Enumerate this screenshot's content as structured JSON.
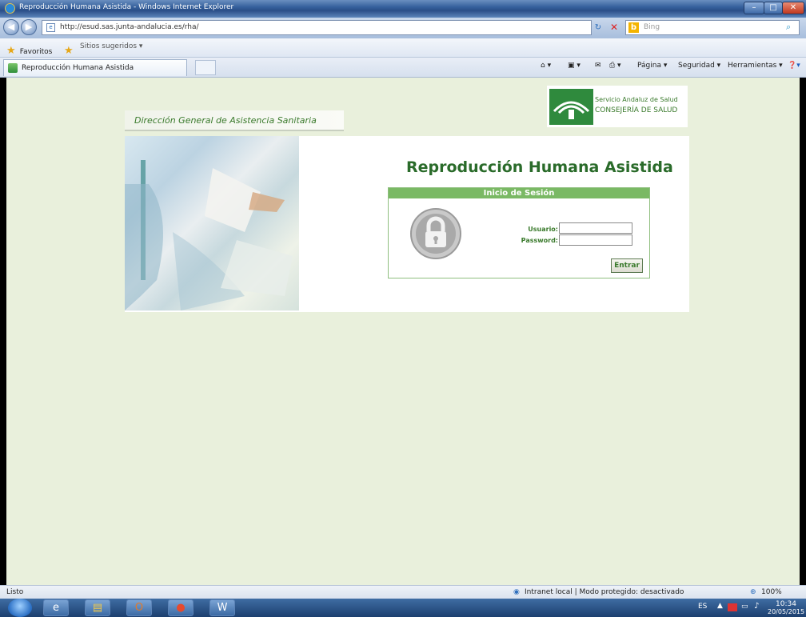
{
  "window": {
    "title": "Reproducción Humana Asistida - Windows Internet Explorer"
  },
  "address": {
    "url": "http://esud.sas.junta-andalucia.es/rha/"
  },
  "search": {
    "placeholder": "Bing"
  },
  "favorites_bar": {
    "favorites_label": "Favoritos",
    "suggested_label": "Sitios sugeridos ▾"
  },
  "tab": {
    "title": "Reproducción Humana Asistida"
  },
  "command_bar": {
    "page": "Página ▾",
    "security": "Seguridad ▾",
    "tools": "Herramientas ▾"
  },
  "page": {
    "header_title": "Dirección General de Asistencia Sanitaria",
    "logo_line1": "Servicio Andaluz de Salud",
    "logo_line2": "CONSEJERÍA DE SALUD",
    "app_title": "Reproducción Humana Asistida",
    "login": {
      "header": "Inicio de Sesión",
      "user_label": "Usuario:",
      "password_label": "Password:",
      "submit": "Entrar",
      "user_value": "",
      "password_value": ""
    }
  },
  "status": {
    "text": "Listo",
    "zone": "Intranet local | Modo protegido: desactivado",
    "zoom": "100%"
  },
  "taskbar": {
    "language": "ES",
    "time": "10:34",
    "date": "20/05/2015"
  },
  "colors": {
    "accent": "#3a7a2c",
    "page_bg": "#e9f0dc",
    "login_header": "#7ab964"
  },
  "icons": [
    "ie-icon",
    "back-arrow-icon",
    "forward-arrow-icon",
    "refresh-icon",
    "stop-icon",
    "bing-icon",
    "search-icon",
    "favorites-star-icon",
    "home-icon",
    "feeds-icon",
    "mail-icon",
    "print-icon",
    "help-icon",
    "lock-icon",
    "globe-icon",
    "start-orb-icon"
  ]
}
